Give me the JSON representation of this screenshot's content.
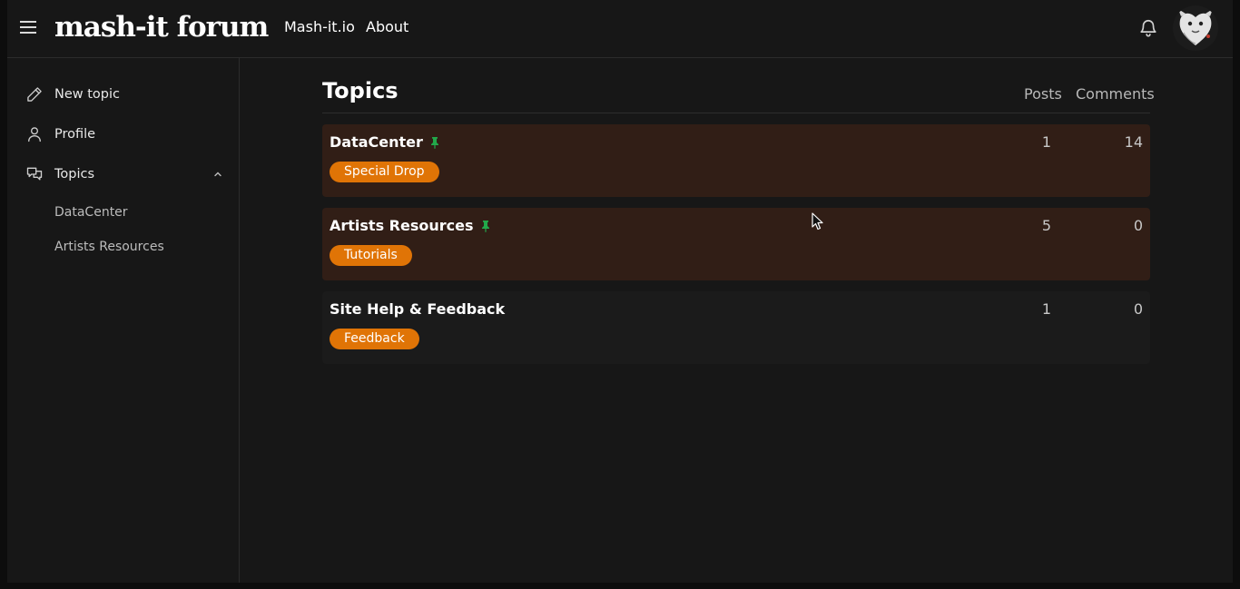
{
  "header": {
    "logo": "mash-it forum",
    "nav_links": [
      "Mash-it.io",
      "About"
    ],
    "icons": {
      "menu": "hamburger-icon",
      "notifications": "bell-icon"
    }
  },
  "sidebar": {
    "items": [
      {
        "label": "New topic",
        "icon": "pencil-icon"
      },
      {
        "label": "Profile",
        "icon": "person-icon"
      },
      {
        "label": "Topics",
        "icon": "chat-icon",
        "expanded": true
      }
    ],
    "sub_items": [
      "DataCenter",
      "Artists Resources"
    ]
  },
  "main": {
    "title": "Topics",
    "columns": [
      "Posts",
      "Comments"
    ],
    "topics": [
      {
        "name": "DataCenter",
        "pinned": true,
        "tag": "Special Drop",
        "posts": "1",
        "comments": "14"
      },
      {
        "name": "Artists Resources",
        "pinned": true,
        "tag": "Tutorials",
        "posts": "5",
        "comments": "0"
      },
      {
        "name": "Site Help & Feedback",
        "pinned": false,
        "tag": "Feedback",
        "posts": "1",
        "comments": "0"
      }
    ]
  },
  "colors": {
    "background": "#171717",
    "pinned_row": "#311e16",
    "tag": "#e07406",
    "pin_icon": "#22a84a"
  }
}
